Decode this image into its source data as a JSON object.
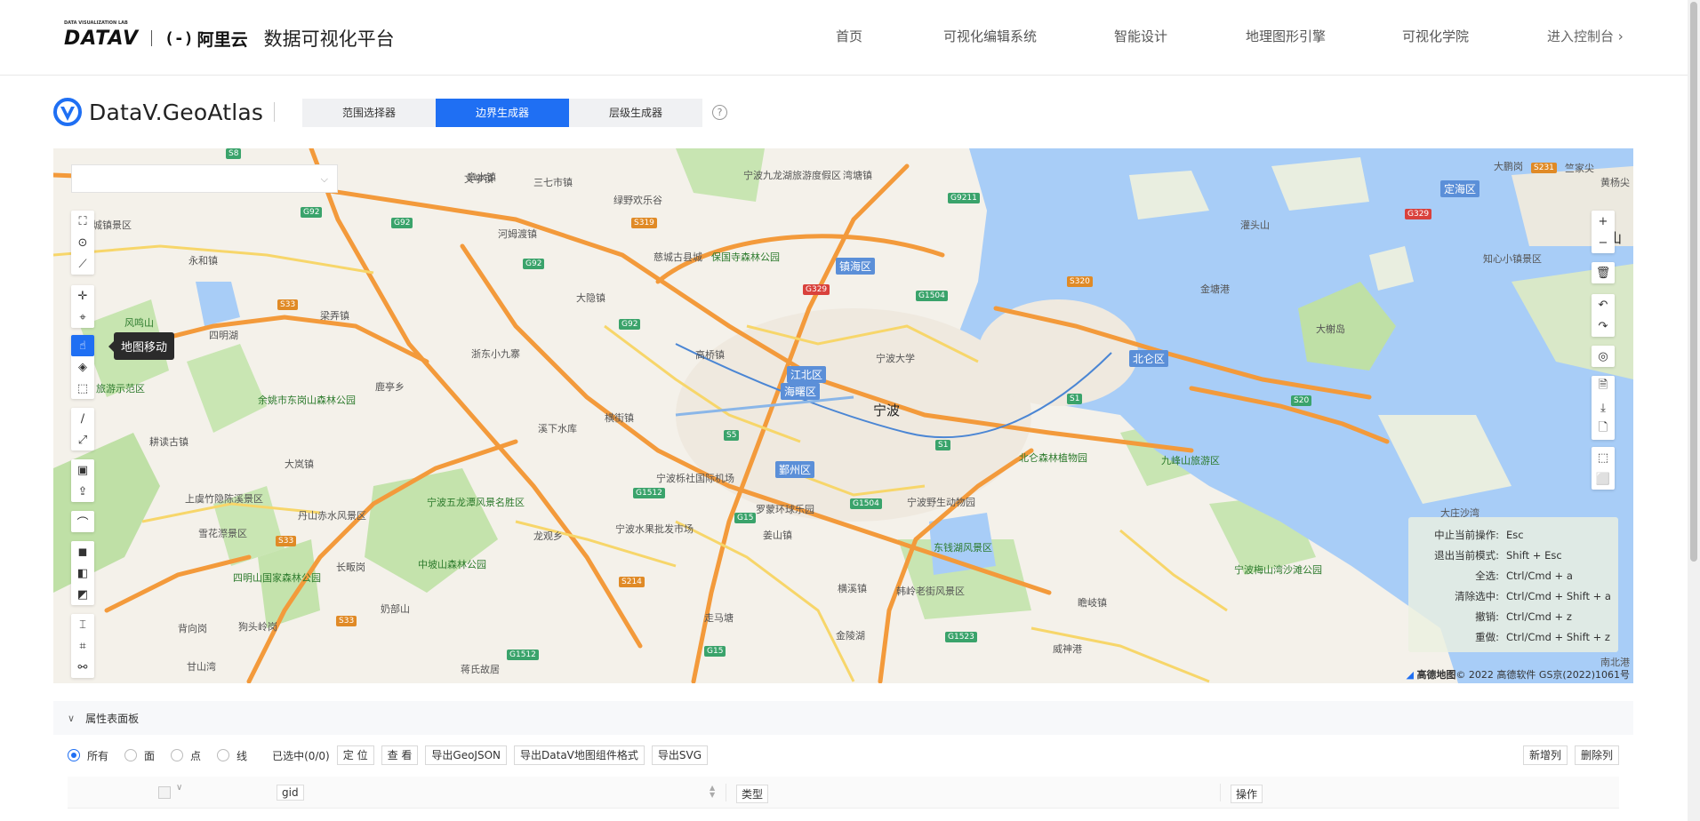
{
  "header": {
    "brand_datav": "DATAV",
    "brand_datav_sub": "DATA VISUALIZATION LAB",
    "brand_ali": "阿里云",
    "brand_ali_mark": "(-)",
    "platform": "数据可视化平台",
    "nav": [
      "首页",
      "可视化编辑系统",
      "智能设计",
      "地理图形引擎",
      "可视化学院"
    ],
    "console": "进入控制台 ›"
  },
  "app": {
    "title": "DataV.GeoAtlas",
    "tabs": [
      "范围选择器",
      "边界生成器",
      "层级生成器"
    ],
    "active_tab": 1,
    "help": "?"
  },
  "map": {
    "tooltip": "地图移动",
    "center_label": "宁波",
    "districts": [
      "江北区",
      "海曙区",
      "鄞州区",
      "镇海区",
      "北仑区",
      "定海区"
    ],
    "labels": [
      "宁波九龙湖旅游度假区",
      "绿野欢乐谷",
      "慈城古县城",
      "保国寺森林公园",
      "宁波大学",
      "浙东小九寨",
      "溪下水库",
      "四明湖",
      "余姚市东岗山森林公园",
      "耕读古镇",
      "上虞竹隐陈溪景区",
      "雪花漈景区",
      "四明山国家森林公园",
      "丹山赤水风景区",
      "宁波五龙潭风景名胜区",
      "中坡山森林公园",
      "长畈岗",
      "奶部山",
      "宁波栎社国际机场",
      "罗蒙环球乐园",
      "宁波野生动物园",
      "宁波水果批发市场",
      "东钱湖风景区",
      "韩岭老街风景区",
      "走马塘",
      "金陵湖",
      "北仑森林植物园",
      "九峰山旅游区",
      "宁波梅山湾沙滩公园",
      "灌头山",
      "大榭岛",
      "金塘港",
      "知心小镇景区",
      "舟山",
      "大鹏岗",
      "黄杨尖",
      "竺家尖",
      "背向岗",
      "狗头岭岗",
      "甘山湾",
      "蒋氏故居",
      "风鸣山",
      "旅游示范区",
      "城镇景区",
      "永和镇",
      "大隐镇",
      "鹿亭乡",
      "横街镇",
      "章水镇",
      "龙观乡",
      "大岚镇",
      "梁弄镇",
      "河姆渡镇",
      "三七市镇",
      "文亭镇",
      "姜山镇",
      "横溪镇",
      "瞻岐镇",
      "威神港",
      "高桥镇",
      "湾塘镇",
      "大庄沙湾",
      "南北港"
    ],
    "road_shields_green": [
      "G92",
      "G92",
      "G92",
      "G92",
      "G9211",
      "G1504",
      "G1504",
      "G1512",
      "G1512",
      "G1523",
      "G15",
      "G15",
      "S5",
      "S1",
      "S1",
      "S20",
      "S8"
    ],
    "road_shields_orange": [
      "S319",
      "S33",
      "S33",
      "S33",
      "S214",
      "S320",
      "S231"
    ],
    "road_shields_red": [
      "G329",
      "G329"
    ],
    "left_tools": [
      [
        "rect-select-icon",
        "circle-select-icon",
        "line-draw-icon"
      ],
      [
        "move-icon",
        "locate-icon"
      ],
      [
        "hand-icon",
        "magic-select-icon",
        "box-select-icon"
      ],
      [
        "pen-icon",
        "expand-icon"
      ],
      [
        "terminal-icon",
        "upload-icon"
      ],
      [
        "curve-icon"
      ],
      [
        "merge-icon",
        "intersect-icon",
        "subtract-icon"
      ],
      [
        "split-icon",
        "crop-icon",
        "link-icon"
      ]
    ],
    "left_tool_glyphs": [
      [
        "⛶",
        "⊙",
        "⟋"
      ],
      [
        "✛",
        "⌖"
      ],
      [
        "☝",
        "◈",
        "⬚"
      ],
      [
        "∕",
        "⤢"
      ],
      [
        "▣",
        "⇪"
      ],
      [
        "⌒"
      ],
      [
        "◼",
        "◧",
        "◩"
      ],
      [
        "⌶",
        "⌗",
        "⚯"
      ]
    ],
    "zoom_in": "+",
    "zoom_out": "−",
    "right_tool_glyphs": [
      [
        "🗑"
      ],
      [
        "↶",
        "↷"
      ],
      [
        "◎"
      ],
      [
        "🗎",
        "⤓",
        "🗋"
      ],
      [
        "⬚",
        "⬜"
      ]
    ],
    "right_tool_names": [
      [
        "trash-icon"
      ],
      [
        "undo-icon",
        "redo-icon"
      ],
      [
        "eye-icon"
      ],
      [
        "file-icon",
        "download-icon",
        "file-export-icon"
      ],
      [
        "select-all-icon",
        "deselect-icon"
      ]
    ],
    "shortcuts": [
      {
        "k": "中止当前操作:",
        "v": "Esc"
      },
      {
        "k": "退出当前模式:",
        "v": "Shift + Esc"
      },
      {
        "k": "全选:",
        "v": "Ctrl/Cmd + a"
      },
      {
        "k": "清除选中:",
        "v": "Ctrl/Cmd + Shift + a"
      },
      {
        "k": "撤销:",
        "v": "Ctrl/Cmd + z"
      },
      {
        "k": "重做:",
        "v": "Ctrl/Cmd + Shift + z"
      }
    ],
    "copyright_brand": "高德地图",
    "copyright": "© 2022 高德软件 GS京(2022)1061号"
  },
  "panel": {
    "title": "属性表面板",
    "filters": [
      "所有",
      "面",
      "点",
      "线"
    ],
    "selected": "已选中(0/0)",
    "buttons": [
      "定 位",
      "查 看",
      "导出GeoJSON",
      "导出DataV地图组件格式",
      "导出SVG"
    ],
    "right_buttons": [
      "新增列",
      "删除列"
    ],
    "columns": {
      "gid": "gid",
      "type": "类型",
      "op": "操作"
    }
  },
  "colors": {
    "accent": "#1f6ff3",
    "road_orange": "#f39a3b",
    "road_yellow": "#f7d66a",
    "water": "#a8cdf7",
    "park": "#b5dc9a"
  }
}
